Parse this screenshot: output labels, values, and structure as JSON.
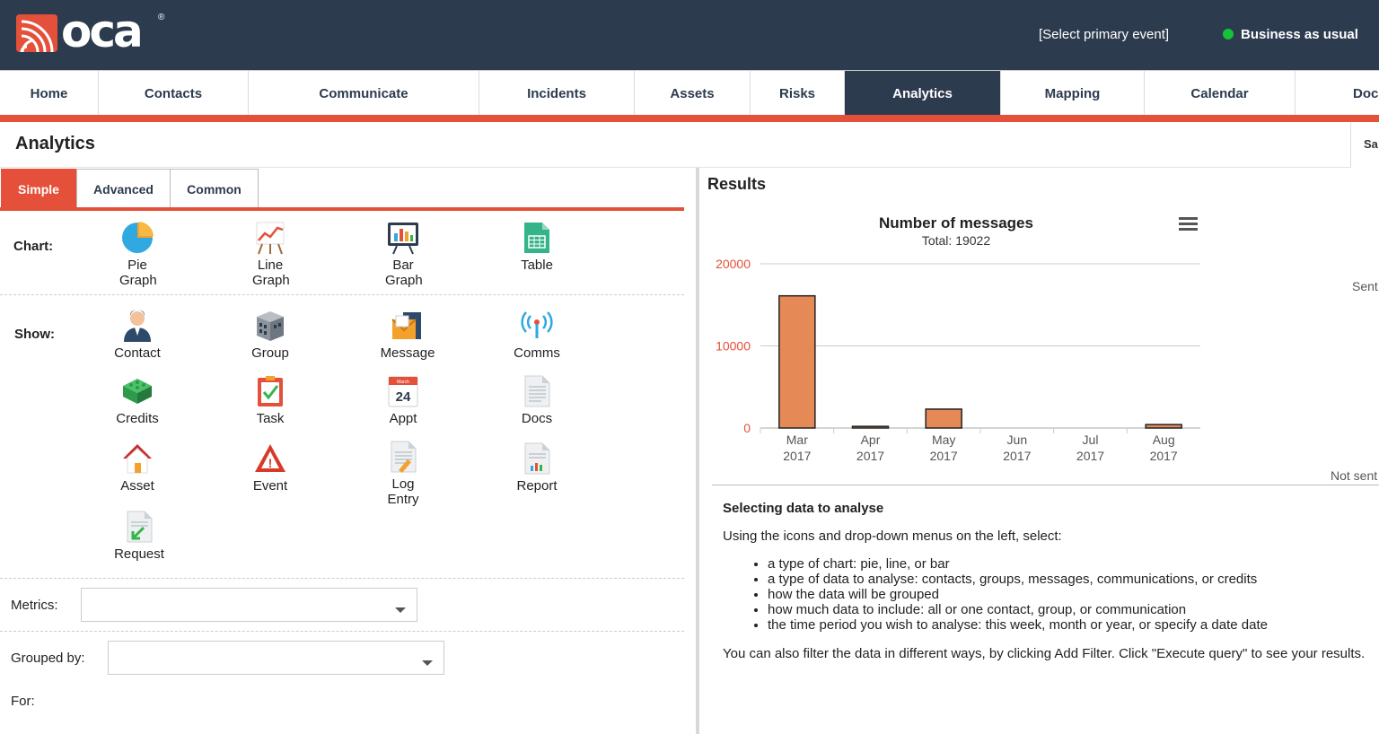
{
  "header": {
    "logo_text": "oca",
    "logo_reg": "®",
    "primary_event": "[Select primary event]",
    "status": "Business as usual",
    "status_color": "#15c23b"
  },
  "nav": {
    "items": [
      "Home",
      "Contacts",
      "Communicate",
      "Incidents",
      "Assets",
      "Risks",
      "Analytics",
      "Mapping",
      "Calendar",
      "Doc"
    ],
    "active": "Analytics"
  },
  "page": {
    "title": "Analytics",
    "save_label": "Sa"
  },
  "tabs": {
    "items": [
      "Simple",
      "Advanced",
      "Common"
    ],
    "active": "Simple"
  },
  "chart_section": {
    "label": "Chart:",
    "items": [
      {
        "label": "Pie Graph",
        "icon": "pie-chart-icon"
      },
      {
        "label": "Line Graph",
        "icon": "line-chart-icon"
      },
      {
        "label": "Bar Graph",
        "icon": "bar-chart-icon"
      },
      {
        "label": "Table",
        "icon": "table-icon"
      }
    ]
  },
  "show_section": {
    "label": "Show:",
    "items": [
      {
        "label": "Contact",
        "icon": "contact-icon"
      },
      {
        "label": "Group",
        "icon": "group-icon"
      },
      {
        "label": "Message",
        "icon": "message-icon"
      },
      {
        "label": "Comms",
        "icon": "comms-icon"
      },
      {
        "label": "Credits",
        "icon": "credits-icon"
      },
      {
        "label": "Task",
        "icon": "task-icon"
      },
      {
        "label": "Appt",
        "icon": "calendar-icon",
        "day": "24",
        "month": "March"
      },
      {
        "label": "Docs",
        "icon": "document-icon"
      },
      {
        "label": "Asset",
        "icon": "asset-icon"
      },
      {
        "label": "Event",
        "icon": "warning-icon",
        "mark": "!"
      },
      {
        "label": "Log Entry",
        "icon": "log-entry-icon"
      },
      {
        "label": "Report",
        "icon": "report-icon"
      },
      {
        "label": "Request",
        "icon": "request-icon"
      }
    ]
  },
  "form": {
    "metrics_label": "Metrics:",
    "grouped_label": "Grouped by:",
    "for_label": "For:"
  },
  "results": {
    "title": "Results",
    "side_sent": "Sent",
    "side_not_sent": "Not sent"
  },
  "chart_data": {
    "type": "bar",
    "title": "Number of messages",
    "subtitle": "Total: 19022",
    "categories": [
      "Mar 2017",
      "Apr 2017",
      "May 2017",
      "Jun 2017",
      "Jul 2017",
      "Aug 2017"
    ],
    "values": [
      16100,
      200,
      2300,
      0,
      0,
      420
    ],
    "ylim": [
      0,
      20000
    ],
    "yticks": [
      0,
      10000,
      20000
    ],
    "bar_color": "#e58a57",
    "grid": true
  },
  "help": {
    "title": "Selecting data to analyse",
    "intro": "Using the icons and drop-down menus on the left, select:",
    "bullets": [
      "a type of chart: pie, line, or bar",
      "a type of data to analyse: contacts, groups, messages, communications, or credits",
      "how the data will be grouped",
      "how much data to include: all or one contact, group, or communication",
      "the time period you wish to analyse: this week, month or year, or specify a date date"
    ],
    "outro": "You can also filter the data in different ways, by clicking Add Filter. Click \"Execute query\" to see your results."
  }
}
